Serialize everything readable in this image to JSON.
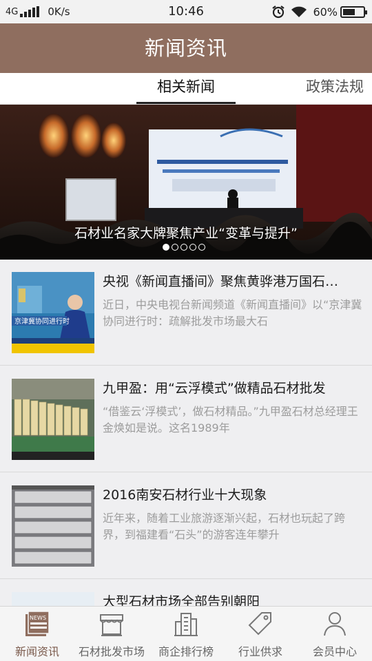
{
  "status_bar": {
    "network": "4G",
    "speed": "0K/s",
    "time": "10:46",
    "battery": "60%",
    "battery_level": 0.6
  },
  "header": {
    "title": "新闻资讯",
    "color": "#8f6e5f"
  },
  "tabs": [
    {
      "label": "相关新闻",
      "active": true
    },
    {
      "label": "政策法规",
      "active": false
    }
  ],
  "banner": {
    "screen_text": "2015第十四届中国（上海）石材高峰论坛",
    "caption": "石材业名家大牌聚焦产业“变革与提升”",
    "slide_count": 5,
    "active_slide": 1
  },
  "news": [
    {
      "title": "央视《新闻直播间》聚焦黄骅港万国石…",
      "desc": "近日，中央电视台新闻频道《新闻直播间》以“京津冀协同进行时：疏解批发市场最大石",
      "thumb_text": "京津冀协同进行时"
    },
    {
      "title": "九甲盈：用“云浮模式”做精品石材批发",
      "desc": "“借鉴云‘浮模式’，做石材精品。”九甲盈石材总经理王金焕如是说。这名1989年"
    },
    {
      "title": "2016南安石材行业十大现象",
      "desc": "近年来，随着工业旅游逐渐兴起，石材也玩起了跨界，到福建看“石头”的游客连年攀升"
    },
    {
      "title": "大型石材市场全部告别朝阳",
      "desc": ""
    }
  ],
  "bottom_nav": [
    {
      "label": "新闻资讯",
      "icon": "news-icon",
      "active": true
    },
    {
      "label": "石材批发市场",
      "icon": "market-icon",
      "active": false
    },
    {
      "label": "商企排行榜",
      "icon": "buildings-icon",
      "active": false
    },
    {
      "label": "行业供求",
      "icon": "tag-icon",
      "active": false
    },
    {
      "label": "会员中心",
      "icon": "user-icon",
      "active": false
    }
  ],
  "colors": {
    "accent": "#8f6e5f",
    "nav_active": "#7a5a4c"
  }
}
